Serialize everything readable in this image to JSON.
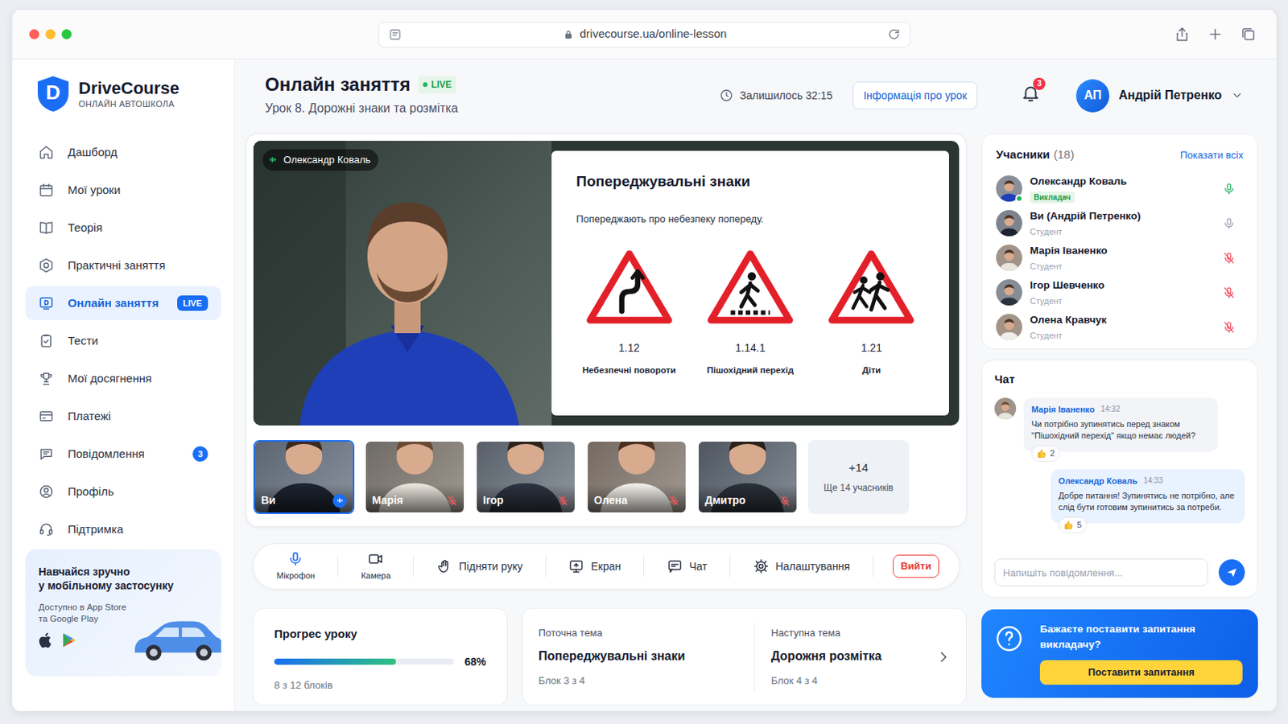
{
  "browser": {
    "url": "drivecourse.ua/online-lesson"
  },
  "brand": {
    "logo_letter": "D",
    "name": "DriveCourse",
    "tagline": "ОНЛАЙН АВТОШКОЛА"
  },
  "sidebar": {
    "items": [
      {
        "label": "Дашборд",
        "selected": false
      },
      {
        "label": "Мої уроки",
        "selected": false
      },
      {
        "label": "Теорія",
        "selected": false
      },
      {
        "label": "Практичні заняття",
        "selected": false
      },
      {
        "label": "Онлайн заняття",
        "selected": true,
        "badge": "LIVE",
        "badge_kind": "pill"
      },
      {
        "label": "Тести",
        "selected": false
      },
      {
        "label": "Мої досягнення",
        "selected": false
      },
      {
        "label": "Платежі",
        "selected": false
      },
      {
        "label": "Повідомлення",
        "selected": false,
        "badge": "3",
        "badge_kind": "count"
      },
      {
        "label": "Профіль",
        "selected": false
      },
      {
        "label": "Підтримка",
        "selected": false
      }
    ],
    "promo": {
      "title": [
        "Навчайся зручно",
        "у мобільному застосунку"
      ],
      "text": [
        "Доступно в App Store",
        "та Google Play"
      ]
    }
  },
  "header": {
    "title": "Онлайн заняття",
    "live": "LIVE",
    "subtitle": "Урок 8. Дорожні знаки та розмітка",
    "timer": "Залишилось 32:15",
    "info_button": "Інформація про урок",
    "notifications": "3",
    "user": {
      "initials": "АП",
      "name": "Андрій Петренко"
    }
  },
  "stage": {
    "presenter": "Олександр Коваль",
    "slide": {
      "title": "Попереджувальні знаки",
      "text": "Попереджають про небезпеку попереду.",
      "signs": [
        {
          "code": "1.12",
          "name": "Небезпечні повороти",
          "kind": "curves"
        },
        {
          "code": "1.14.1",
          "name": "Пішохідний перехід",
          "kind": "crossing"
        },
        {
          "code": "1.21",
          "name": "Діти",
          "kind": "children"
        }
      ]
    },
    "thumbnails": [
      {
        "label": "Ви",
        "selected": true,
        "muted": false
      },
      {
        "label": "Марія",
        "selected": false,
        "muted": true
      },
      {
        "label": "Ігор",
        "selected": false,
        "muted": true
      },
      {
        "label": "Олена",
        "selected": false,
        "muted": true
      },
      {
        "label": "Дмитро",
        "selected": false,
        "muted": true
      }
    ],
    "more": {
      "count": "+14",
      "label": "Ще 14 учасників"
    }
  },
  "controls": [
    {
      "label": "Мікрофон",
      "kind": "stacked",
      "active": true
    },
    {
      "label": "Камера",
      "kind": "stacked",
      "active": false
    },
    {
      "label": "Підняти руку",
      "kind": "inline",
      "active": false
    },
    {
      "label": "Екран",
      "kind": "inline",
      "active": false
    },
    {
      "label": "Чат",
      "kind": "inline",
      "active": false
    },
    {
      "label": "Налаштування",
      "kind": "inline",
      "active": false
    },
    {
      "label": "Вийти",
      "kind": "danger",
      "active": false
    }
  ],
  "progress": {
    "title": "Прогрес уроку",
    "level": 0.68,
    "reading": "68%",
    "sub": "8 з 12 блоків"
  },
  "topics": {
    "current": {
      "label": "Поточна тема",
      "title": "Попереджувальні знаки",
      "sub": "Блок 3 з 4"
    },
    "next": {
      "label": "Наступна тема",
      "title": "Дорожня розмітка",
      "sub": "Блок 4 з 4"
    }
  },
  "participants": {
    "title": "Учасники",
    "count": "(18)",
    "link": "Показати всіх",
    "items": [
      {
        "name": "Олександр Коваль",
        "role": "Викладач",
        "kind": "teacher",
        "online": true,
        "muted": false,
        "speaking": true
      },
      {
        "name": "Ви (Андрій Петренко)",
        "role": "Студент",
        "kind": "student",
        "online": false,
        "muted": false,
        "speaking": false
      },
      {
        "name": "Марія Іваненко",
        "role": "Студент",
        "kind": "student",
        "online": false,
        "muted": true,
        "speaking": false
      },
      {
        "name": "Ігор Шевченко",
        "role": "Студент",
        "kind": "student",
        "online": false,
        "muted": true,
        "speaking": false
      },
      {
        "name": "Олена Кравчук",
        "role": "Студент",
        "kind": "student",
        "online": false,
        "muted": true,
        "speaking": false
      }
    ]
  },
  "chat": {
    "title": "Чат",
    "messages": [
      {
        "author": "Марія Іваненко",
        "time": "14:32",
        "text": "Чи потрібно зупинятись перед знаком \"Пішохідний перехід\" якщо немає людей?",
        "reactions": "2",
        "kind": "student"
      },
      {
        "author": "Олександр Коваль",
        "time": "14:33",
        "text": "Добре питання! Зупинятись не потрібно, але слід бути готовим зупинитись за потреби.",
        "reactions": "5",
        "kind": "teacher"
      }
    ],
    "placeholder": "Напишіть повідомлення..."
  },
  "question": {
    "text": "Бажаєте поставити запитання викладачу?",
    "button": "Поставити запитання"
  }
}
